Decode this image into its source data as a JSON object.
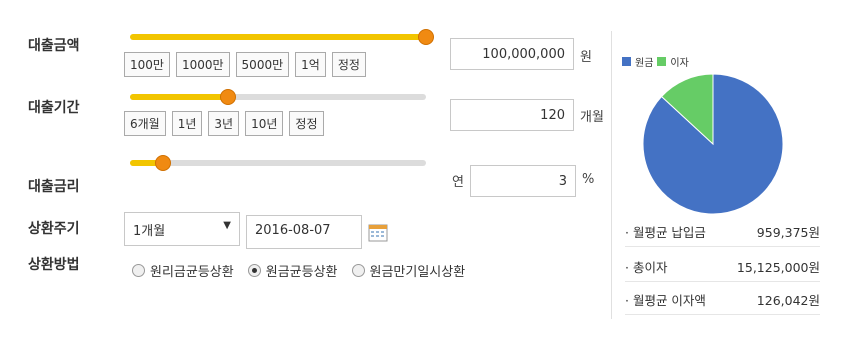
{
  "loan_amount": {
    "label": "대출금액",
    "chips": [
      "100만",
      "1000만",
      "5000만",
      "1억",
      "정정"
    ],
    "value": "100,000,000",
    "unit": "원",
    "slider_fraction": 1.0
  },
  "loan_period": {
    "label": "대출기간",
    "chips": [
      "6개월",
      "1년",
      "3년",
      "10년",
      "정정"
    ],
    "value": "120",
    "unit": "개월",
    "slider_fraction": 0.33
  },
  "interest_rate": {
    "label": "대출금리",
    "prefix": "연",
    "value": "3",
    "unit": "%",
    "slider_fraction": 0.11
  },
  "repayment_cycle": {
    "label": "상환주기",
    "selected": "1개월",
    "date": "2016-08-07"
  },
  "repayment_method": {
    "label": "상환방법",
    "options": [
      "원리금균등상환",
      "원금균등상환",
      "원금만기일시상환"
    ],
    "selected_index": 1
  },
  "chart_data": {
    "type": "pie",
    "categories": [
      "원금",
      "이자"
    ],
    "values": [
      100000000,
      15125000
    ],
    "colors": [
      "#4472c4",
      "#66cc66"
    ]
  },
  "summary": [
    {
      "label": "월평균 납입금",
      "value": "959,375원"
    },
    {
      "label": "총이자",
      "value": "15,125,000원"
    },
    {
      "label": "월평균 이자액",
      "value": "126,042원"
    }
  ]
}
